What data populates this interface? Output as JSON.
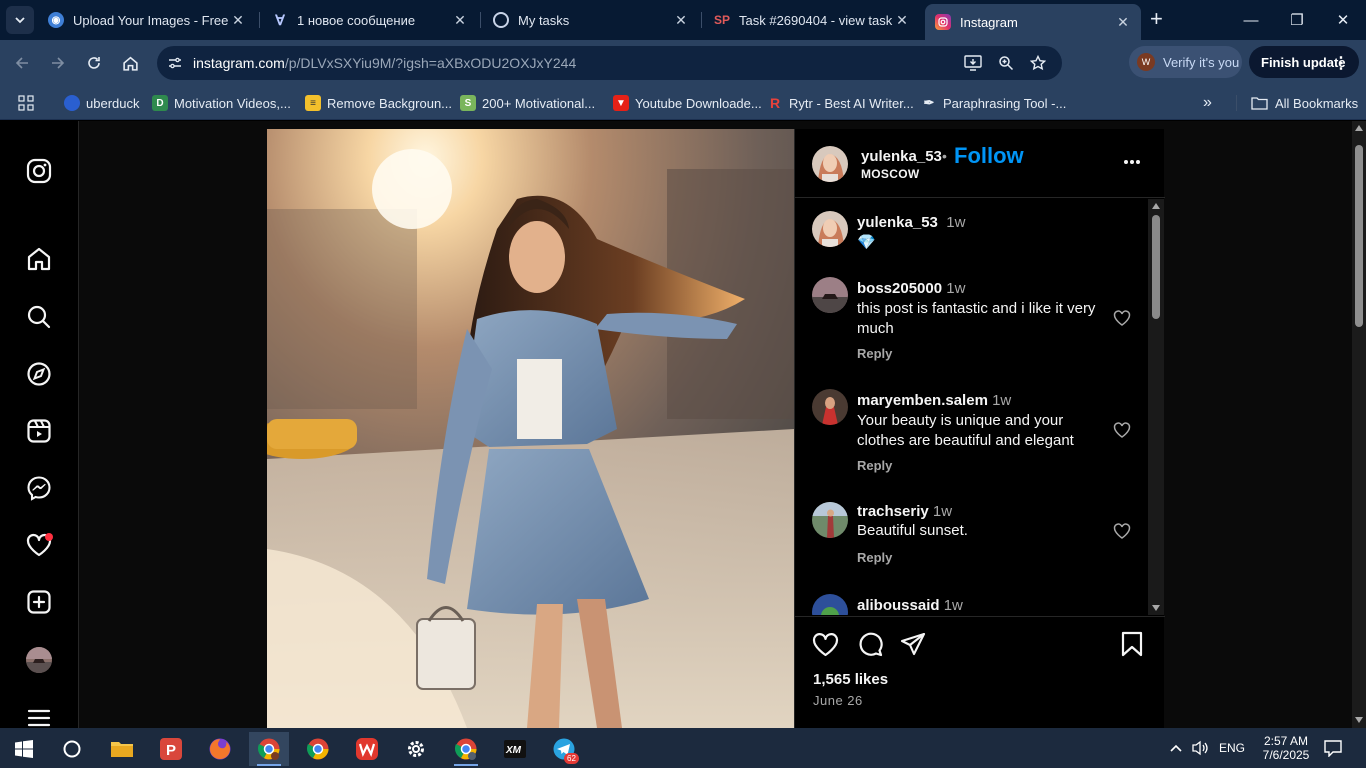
{
  "browser": {
    "tabs": [
      {
        "title": "Upload Your Images - Free I",
        "active": false
      },
      {
        "title": "1 новое сообщение",
        "active": false
      },
      {
        "title": "My tasks",
        "active": false
      },
      {
        "title": "Task #2690404 - view task",
        "active": false
      },
      {
        "title": "Instagram",
        "active": true
      }
    ],
    "url_host": "instagram.com",
    "url_path": "/p/DLVxSXYiu9M/?igsh=aXBxODU2OXJxY244",
    "profile_label": "Verify it's you",
    "profile_initial": "W",
    "finish_update_label": "Finish update",
    "bookmarks": [
      {
        "label": "uberduck",
        "icon": "uberduck-icon"
      },
      {
        "label": "Motivation Videos,...",
        "icon": "motivation-icon"
      },
      {
        "label": "Remove Backgroun...",
        "icon": "removebg-icon"
      },
      {
        "label": "200+ Motivational...",
        "icon": "shopify-icon"
      },
      {
        "label": "Youtube Downloade...",
        "icon": "download-icon"
      },
      {
        "label": "Rytr - Best AI Writer...",
        "icon": "rytr-icon"
      },
      {
        "label": "Paraphrasing Tool -...",
        "icon": "quill-icon"
      }
    ],
    "all_bookmarks_label": "All Bookmarks"
  },
  "post": {
    "author": "yulenka_53",
    "separator": "•",
    "follow_label": "Follow",
    "location": "MOSCOW",
    "caption": {
      "user": "yulenka_53",
      "time": "1w",
      "text": "💎"
    },
    "comments": [
      {
        "user": "boss205000",
        "time": "1w",
        "text": "this post is fantastic and i like it very much",
        "reply": "Reply"
      },
      {
        "user": "maryemben.salem",
        "time": "1w",
        "text": "Your beauty is unique and your clothes are beautiful and elegant",
        "reply": "Reply"
      },
      {
        "user": "trachseriy",
        "time": "1w",
        "text": "Beautiful sunset.",
        "reply": "Reply"
      },
      {
        "user": "aliboussaid",
        "time": "1w",
        "text": "",
        "reply": ""
      }
    ],
    "likes": "1,565 likes",
    "date": "June 26"
  },
  "taskbar": {
    "language": "ENG",
    "time": "2:57 AM",
    "date": "7/6/2025",
    "telegram_badge": "62"
  },
  "colors": {
    "tabstrip": "#071a33",
    "toolbar": "#2a4160",
    "instagram_blue": "#0095f6",
    "notification_red": "#ff3040"
  }
}
